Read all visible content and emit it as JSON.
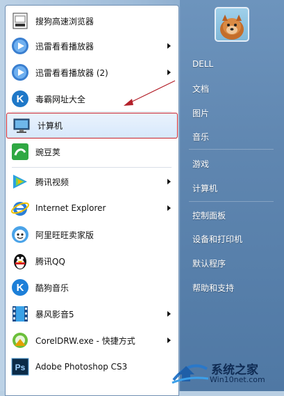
{
  "left_menu": {
    "items": [
      {
        "label": "搜狗高速浏览器",
        "icon": "sogou-browser-icon",
        "submenu": false
      },
      {
        "label": "迅雷看看播放器",
        "icon": "xunlei-player-icon",
        "submenu": true
      },
      {
        "label": "迅雷看看播放器 (2)",
        "icon": "xunlei-player-icon",
        "submenu": true
      },
      {
        "label": "毒霸网址大全",
        "icon": "duba-k-icon",
        "submenu": false
      },
      {
        "label": "计算机",
        "icon": "computer-icon",
        "submenu": false,
        "highlighted": true
      },
      {
        "label": "豌豆荚",
        "icon": "wandoujia-icon",
        "submenu": false
      },
      {
        "label": "腾讯视频",
        "icon": "tencent-video-icon",
        "submenu": true
      },
      {
        "label": "Internet Explorer",
        "icon": "internet-explorer-icon",
        "submenu": true
      },
      {
        "label": "阿里旺旺卖家版",
        "icon": "aliwangwang-icon",
        "submenu": false
      },
      {
        "label": "腾讯QQ",
        "icon": "qq-penguin-icon",
        "submenu": false
      },
      {
        "label": "酷狗音乐",
        "icon": "kugou-k-icon",
        "submenu": false
      },
      {
        "label": "暴风影音5",
        "icon": "baofeng-film-icon",
        "submenu": true
      },
      {
        "label": "CorelDRW.exe - 快捷方式",
        "icon": "coreldraw-icon",
        "submenu": true
      },
      {
        "label": "Adobe Photoshop CS3",
        "icon": "photoshop-ps-icon",
        "submenu": false
      }
    ]
  },
  "right_menu": {
    "items": [
      "DELL",
      "文档",
      "图片",
      "音乐",
      "游戏",
      "计算机",
      "控制面板",
      "设备和打印机",
      "默认程序",
      "帮助和支持"
    ]
  },
  "watermark": {
    "title": "系统之家",
    "url": "Win10net.com"
  },
  "colors": {
    "highlight_border": "#c7202a",
    "annotation_arrow": "#b3202a",
    "right_pane": "#5f86b0"
  }
}
